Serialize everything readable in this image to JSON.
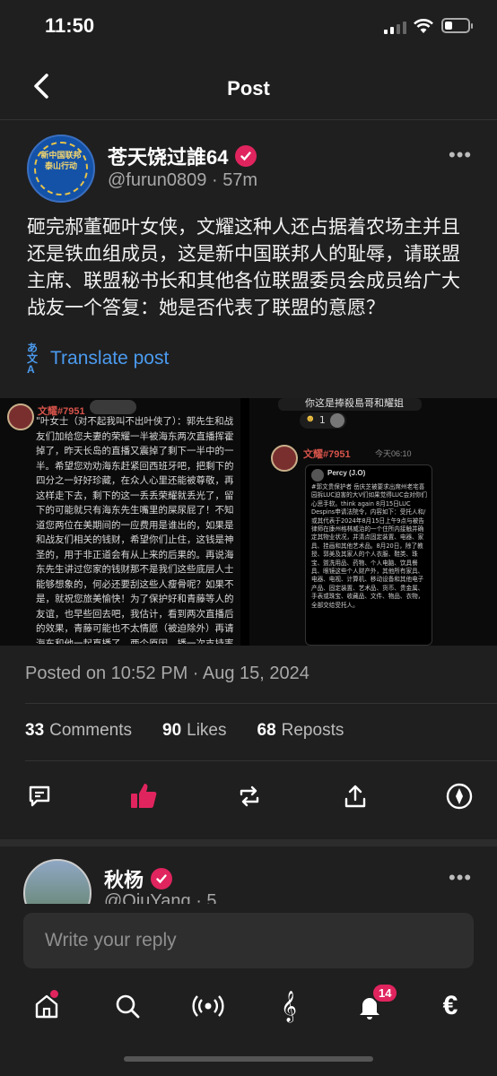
{
  "status_bar": {
    "time": "11:50",
    "battery_level": 0.35
  },
  "header": {
    "title": "Post"
  },
  "post": {
    "author_name": "苍天饶过誰64",
    "handle": "@furun0809",
    "separator": "·",
    "age": "57m",
    "avatar_text": "新中国联邦泰山行动",
    "body": "砸完郝董砸叶女侠，文耀这种人还占据着农场主并且还是铁血组成员，这是新中国联邦人的耻辱，请联盟主席、联盟秘书长和其他各位联盟委员会成员给广大战友一个答复：她是否代表了联盟的意愿？",
    "translate_label": "Translate post",
    "posted_on": "Posted on 10:52 PM · Aug 15, 2024"
  },
  "media": {
    "left_name": "文耀#7951",
    "left_text": "\"叶女士（对不起我叫不出叶侠了）：郭先生和战友们加给您夫妻的荣耀一半被海东两次直播挥霍掉了，昨天长岛的直播又震掉了剩下一半中的一半。希望您劝劝海东赶紧回西班牙吧，把剩下的四分之一好好珍藏，在众人心里还能被尊敬，再这样走下去，剩下的这一丢丢荣耀就丢光了，留下的可能就只有海东先生嘴里的屎尿屁了！不知道您两位在美期间的一应费用是谁出的，如果是和战友们相关的钱财，希望你们止住，这钱是神圣的，用于非正道会有从上来的后果的。再说海东先生讲过您家的钱财那不是我们这些底层人士能够想象的，何必还要刮这些人瘦骨呢？如果不是，就祝您旅美愉快！为了保护好和青藤等人的友谊，也早些回去吧，我估计，看到两次直播后的效果，青藤可能也不太情愿（被迫除外）再请海东和他一起直播了，两个原因，播一次支持率下降一次，此其一；极大损伤青藤的形象和威望（对海东也有伤害但青藤不会在意），此其二。此外，您夫妻对物质的欲望与青藤",
    "right_top_text": "你这是捧殺島哥和耀姐",
    "right_reaction_count": "1",
    "right_name": "文耀#7951",
    "right_time": "今天06:10",
    "inner_author": "Percy (J.O)",
    "inner_text": "#郭文贵保护者 岳庆芝被要求出席州老宅喜园拆LUC迫害的大V们如果觉得LUC会对你们心思手软。think again 8月15日LUC Despins申请法院令，内容如下：受托人和/或其代表于2024年8月15日上午9点与被告律师在康州格林威治的一个住所内接触并确定其物业状况，并清点固定装置、电器、家具、挂画和其他艺术品。8月20日，除了教授、郭美及其家人的个人衣服、鞋类、珠宝、盥洗用品、药物、个人电脑、饮具餐具、眼镜这些个人财产外，其他所有家具、电器、电视、计算机、移动设备和其他电子产品、固定装置、艺术品、货币、贵金属、手表或珠宝、收藏品、文件、物品、衣物，全部交给受托人。"
  },
  "stats": [
    {
      "count": "33",
      "label": "Comments"
    },
    {
      "count": "90",
      "label": "Likes"
    },
    {
      "count": "68",
      "label": "Reposts"
    }
  ],
  "reply": {
    "author_name": "秋杨",
    "handle_partial": "@QiuYang · 5"
  },
  "composer": {
    "placeholder": "Write your reply"
  },
  "tabbar": {
    "notifications_badge": "14"
  },
  "colors": {
    "accent_blue": "#4b9bf0",
    "like_red": "#e0245e",
    "background": "#1f1f1f"
  }
}
